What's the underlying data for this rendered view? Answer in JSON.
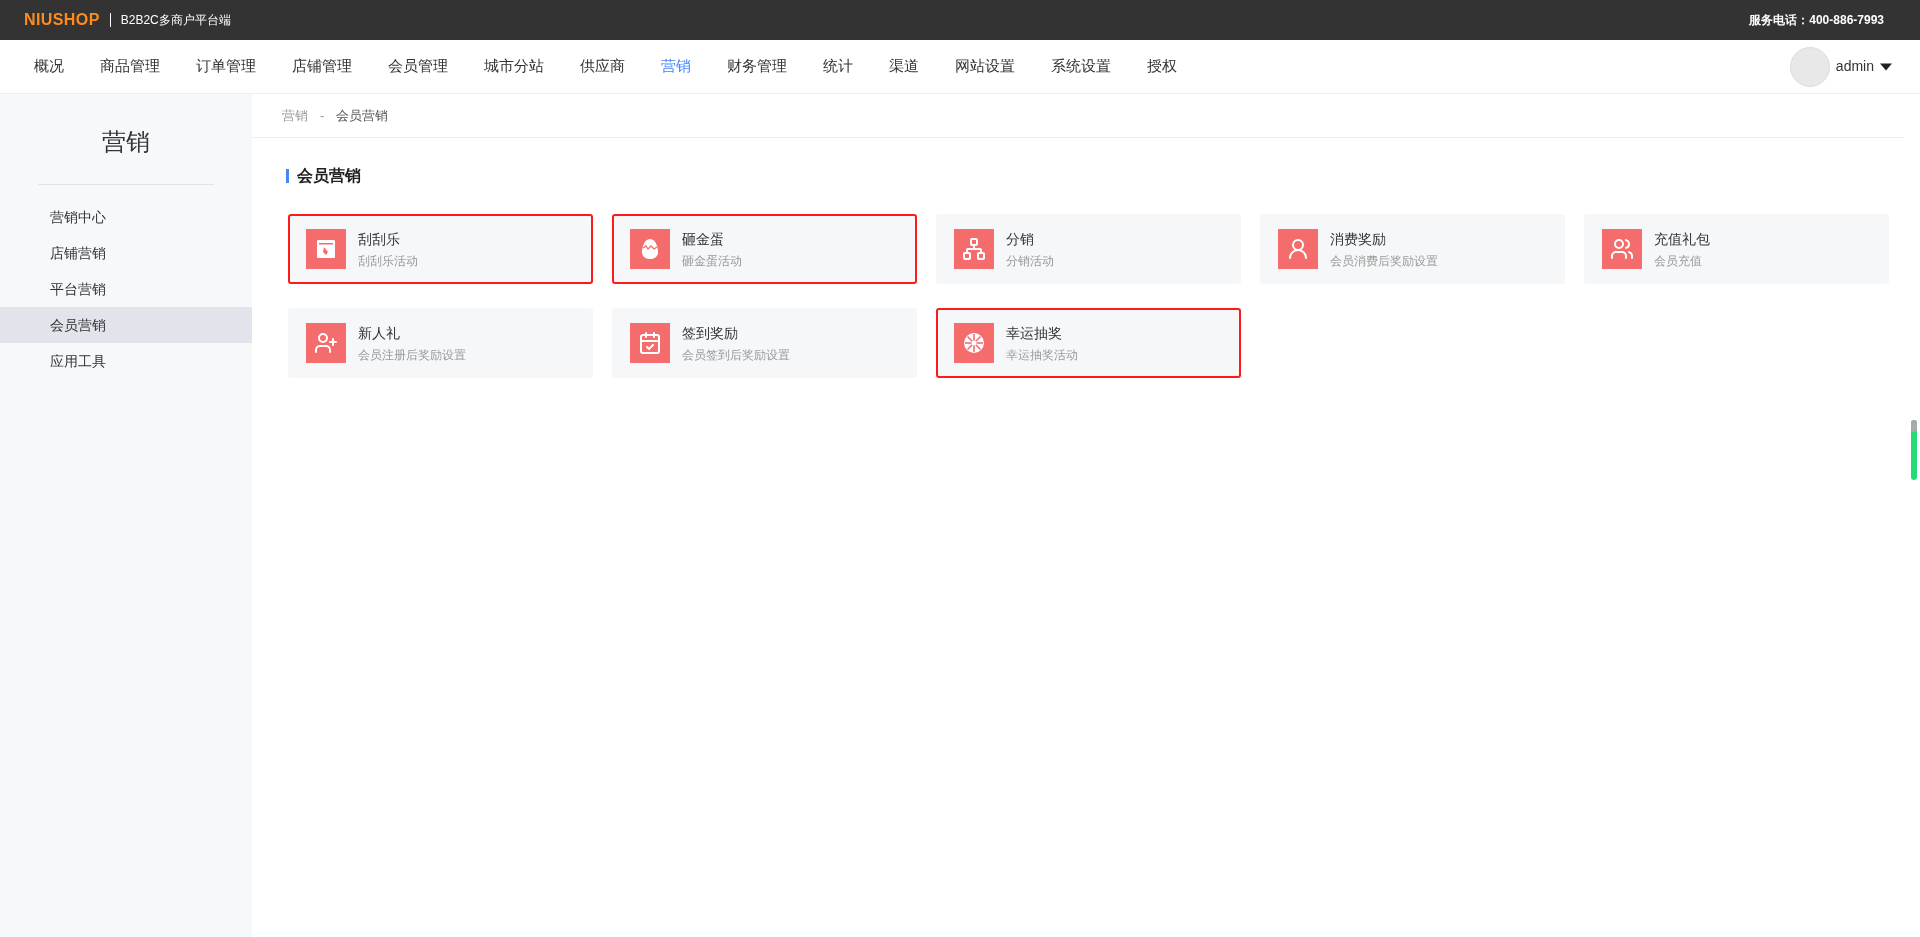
{
  "header": {
    "logo": "NIUSHOP",
    "subtitle": "B2B2C多商户平台端",
    "service": "服务电话：400-886-7993"
  },
  "nav": [
    {
      "label": "概况",
      "selected": false
    },
    {
      "label": "商品管理",
      "selected": false
    },
    {
      "label": "订单管理",
      "selected": false
    },
    {
      "label": "店铺管理",
      "selected": false
    },
    {
      "label": "会员管理",
      "selected": false
    },
    {
      "label": "城市分站",
      "selected": false
    },
    {
      "label": "供应商",
      "selected": false
    },
    {
      "label": "营销",
      "selected": true
    },
    {
      "label": "财务管理",
      "selected": false
    },
    {
      "label": "统计",
      "selected": false
    },
    {
      "label": "渠道",
      "selected": false
    },
    {
      "label": "网站设置",
      "selected": false
    },
    {
      "label": "系统设置",
      "selected": false
    },
    {
      "label": "授权",
      "selected": false
    }
  ],
  "user": {
    "name": "admin"
  },
  "sidebar": {
    "title": "营销",
    "items": [
      {
        "label": "营销中心",
        "selected": false
      },
      {
        "label": "店铺营销",
        "selected": false
      },
      {
        "label": "平台营销",
        "selected": false
      },
      {
        "label": "会员营销",
        "selected": true
      },
      {
        "label": "应用工具",
        "selected": false
      }
    ]
  },
  "breadcrumb": [
    "营销",
    "-",
    "会员营销"
  ],
  "section": {
    "title": "会员营销"
  },
  "cards": [
    {
      "kind": "scratch",
      "title": "刮刮乐",
      "desc": "刮刮乐活动",
      "highlighted": true
    },
    {
      "kind": "egg",
      "title": "砸金蛋",
      "desc": "砸金蛋活动",
      "highlighted": true
    },
    {
      "kind": "tree",
      "title": "分销",
      "desc": "分销活动",
      "highlighted": false
    },
    {
      "kind": "user-yen",
      "title": "消费奖励",
      "desc": "会员消费后奖励设置",
      "highlighted": false
    },
    {
      "kind": "users-yen",
      "title": "充值礼包",
      "desc": "会员充值",
      "highlighted": false
    },
    {
      "kind": "user-plus",
      "title": "新人礼",
      "desc": "会员注册后奖励设置",
      "highlighted": false
    },
    {
      "kind": "calendar",
      "title": "签到奖励",
      "desc": "会员签到后奖励设置",
      "highlighted": false
    },
    {
      "kind": "wheel",
      "title": "幸运抽奖",
      "desc": "幸运抽奖活动",
      "highlighted": true
    }
  ]
}
